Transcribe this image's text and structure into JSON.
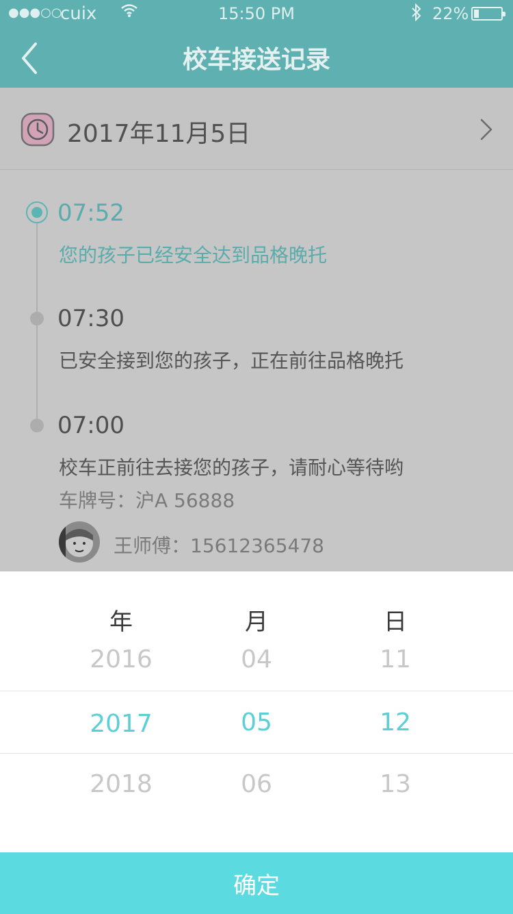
{
  "status_bar": {
    "signal": "●●●○○",
    "carrier": "cuix",
    "time": "15:50 PM",
    "battery_percent": "22%",
    "battery_level": 0.22
  },
  "nav": {
    "title": "校车接送记录"
  },
  "date_row": {
    "date": "2017年11月5日"
  },
  "timeline": {
    "events": [
      {
        "time": "07:52",
        "message": "您的孩子已经安全达到品格晚托",
        "active": true
      },
      {
        "time": "07:30",
        "message": "已安全接到您的孩子，正在前往品格晚托",
        "active": false
      },
      {
        "time": "07:00",
        "message": "校车正前往去接您的孩子，请耐心等待哟",
        "active": false
      }
    ],
    "plate": "车牌号：沪A 56888",
    "driver": "王师傅：15612365478"
  },
  "picker": {
    "headers": {
      "year": "年",
      "month": "月",
      "day": "日"
    },
    "year": {
      "prev": "2016",
      "selected": "2017",
      "next": "2018"
    },
    "month": {
      "prev": "04",
      "selected": "05",
      "next": "06"
    },
    "day": {
      "prev": "11",
      "selected": "12",
      "next": "13"
    }
  },
  "confirm_label": "确定",
  "colors": {
    "accent": "#5bdbe0",
    "nav_dimmed": "#5fb1b1",
    "timeline_active": "#5aabab",
    "overlay_gray": "#c6c6c6"
  }
}
